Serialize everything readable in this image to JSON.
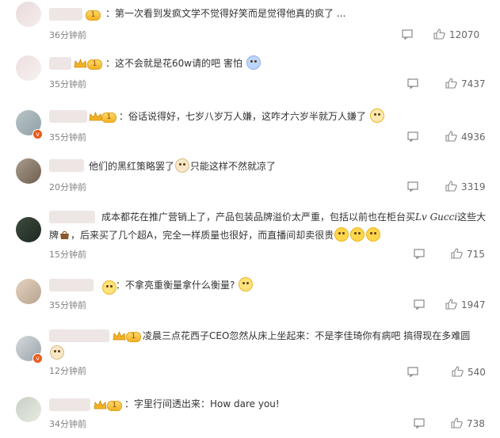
{
  "comments": [
    {
      "text": "第一次看到发疯文学不觉得好笑而是觉得他真的疯了 ...",
      "time": "36分钟前",
      "likes": "12070"
    },
    {
      "text": "这不会就是花60w请的吧 害怕",
      "time": "35分钟前",
      "likes": "7437"
    },
    {
      "text": "俗话说得好，七岁八岁万人嫌，这咋才六岁半就万人嫌了",
      "time": "35分钟前",
      "likes": "4936"
    },
    {
      "text": "他们的黑红策略罢了",
      "text2": "只能这样不然就凉了",
      "time": "20分钟前",
      "likes": "3319"
    },
    {
      "text": "成本都花在推广营销上了，产品包装品牌溢价太严重，包括以前也在柜台买",
      "brand": "Lv Gucci",
      "text_tail": "这些大",
      "line2a": "牌",
      "line2b": "，后来买了几个超A，完全一样质量也很好，而直播间却卖很贵",
      "time": "15分钟前",
      "likes": "715"
    },
    {
      "text": "不拿亮重衡量拿什么衡量?",
      "time": "35分钟前",
      "likes": "1947"
    },
    {
      "text": "凌晨三点花西子CEO忽然从床上坐起来：不是李佳琦你有病吧 搞得现在多难圆",
      "time": "12分钟前",
      "likes": "540"
    },
    {
      "text": "字里行间透出来：How dare you!",
      "time": "34分钟前",
      "likes": "738"
    }
  ],
  "colors": {
    "text": "#333333",
    "meta": "#808080",
    "level_badge": "#f2b224",
    "verified_badge": "#ea5a1a"
  },
  "icons": {
    "reply": "comment-icon",
    "like": "thumbs-up-icon",
    "level": "crown-level-badge-icon",
    "verified": "verified-v-icon"
  }
}
